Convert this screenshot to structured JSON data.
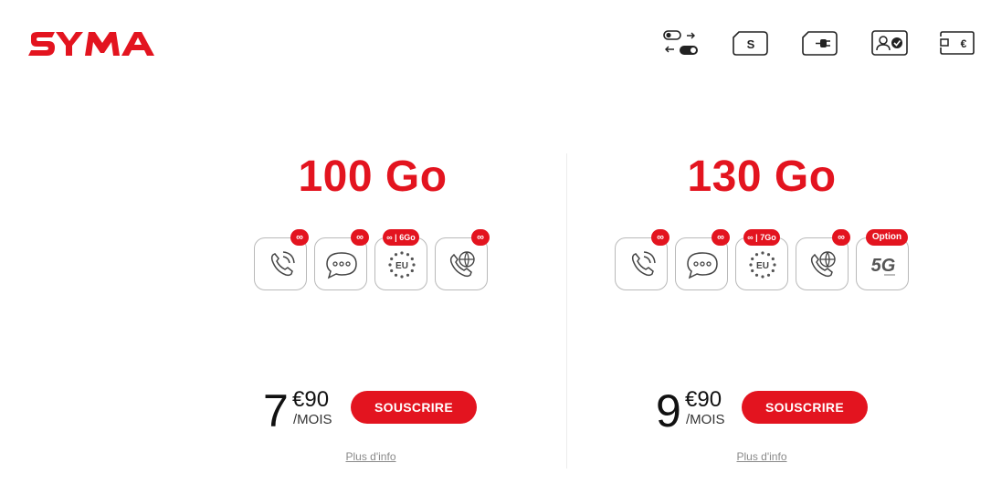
{
  "brand": {
    "logo_text": "SYMA",
    "color": "#e3141f"
  },
  "header": {
    "icons": [
      "switch-toggle-icon",
      "sim-s-icon",
      "sim-plug-icon",
      "account-verified-icon",
      "wallet-euro-icon"
    ]
  },
  "plans": [
    {
      "title": "100 Go",
      "features": [
        {
          "icon": "phone-call-icon",
          "badge": "∞"
        },
        {
          "icon": "sms-bubble-icon",
          "badge": "∞"
        },
        {
          "icon": "eu-roaming-icon",
          "badge": "∞ | 6Go",
          "icon_label": "EU"
        },
        {
          "icon": "international-call-icon",
          "badge": "∞"
        }
      ],
      "price_main": "7",
      "price_cents": "€90",
      "price_unit": "/MOIS",
      "cta_label": "SOUSCRIRE",
      "more_info_label": "Plus d'info"
    },
    {
      "title": "130 Go",
      "features": [
        {
          "icon": "phone-call-icon",
          "badge": "∞"
        },
        {
          "icon": "sms-bubble-icon",
          "badge": "∞"
        },
        {
          "icon": "eu-roaming-icon",
          "badge": "∞ | 7Go",
          "icon_label": "EU"
        },
        {
          "icon": "international-call-icon",
          "badge": "∞"
        },
        {
          "icon": "5g-icon",
          "badge": "Option",
          "icon_label": "5G"
        }
      ],
      "price_main": "9",
      "price_cents": "€90",
      "price_unit": "/MOIS",
      "cta_label": "SOUSCRIRE",
      "more_info_label": "Plus d'info"
    }
  ]
}
